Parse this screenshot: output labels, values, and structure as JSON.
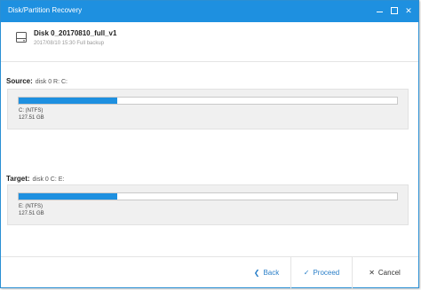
{
  "window": {
    "title": "Disk/Partition Recovery"
  },
  "backup": {
    "name": "Disk 0_20170810_full_v1",
    "meta": "2017/08/10 15:30 Full backup"
  },
  "source": {
    "label": "Source:",
    "value": "disk 0 R: C:",
    "partition": {
      "fs": "C: (NTFS)",
      "size": "127.51 GB",
      "used_fraction": 0.26
    }
  },
  "target": {
    "label": "Target:",
    "value": "disk 0 C: E:",
    "partition": {
      "fs": "E: (NTFS)",
      "size": "127.51 GB",
      "used_fraction": 0.26
    }
  },
  "footer": {
    "back": "Back",
    "proceed": "Proceed",
    "cancel": "Cancel"
  },
  "colors": {
    "accent": "#1e90e0",
    "link": "#2a7fc8"
  }
}
